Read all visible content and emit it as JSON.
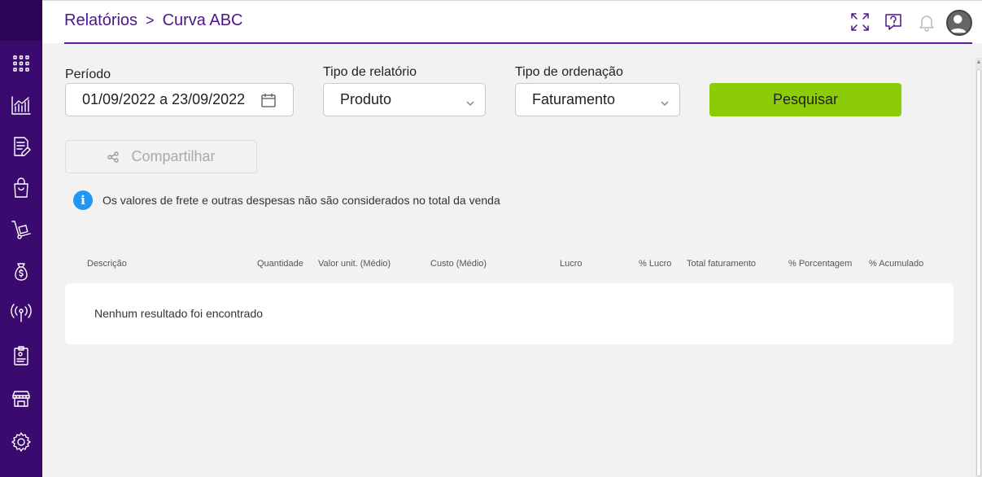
{
  "header": {
    "breadcrumb": [
      "Relatórios",
      "Curva ABC"
    ],
    "breadcrumb_separator": ">"
  },
  "sidebar": {
    "items": [
      {
        "icon": "apps-grid-icon"
      },
      {
        "icon": "chart-icon"
      },
      {
        "icon": "document-edit-icon"
      },
      {
        "icon": "shopping-bag-icon"
      },
      {
        "icon": "hand-truck-icon"
      },
      {
        "icon": "money-bag-icon"
      },
      {
        "icon": "broadcast-icon"
      },
      {
        "icon": "clipboard-icon"
      },
      {
        "icon": "store-icon"
      },
      {
        "icon": "gear-icon"
      }
    ]
  },
  "filters": {
    "periodo": {
      "label": "Período",
      "value": "01/09/2022 a 23/09/2022"
    },
    "tipo_relatorio": {
      "label": "Tipo de relatório",
      "value": "Produto"
    },
    "tipo_ordenacao": {
      "label": "Tipo de ordenação",
      "value": "Faturamento"
    },
    "search_button": "Pesquisar",
    "share_button": "Compartilhar"
  },
  "info": {
    "message": "Os valores de frete e outras despesas não são considerados no total da venda"
  },
  "table": {
    "columns": [
      "Descrição",
      "Quantidade",
      "Valor unit. (Médio)",
      "Custo (Médio)",
      "Lucro",
      "% Lucro",
      "Total faturamento",
      "% Porcentagem",
      "% Acumulado"
    ],
    "empty_message": "Nenhum resultado foi encontrado"
  },
  "colors": {
    "sidebar": "#3a0a6e",
    "accent": "#4c168c",
    "search_button": "#8ccc07",
    "info": "#2196f3"
  }
}
